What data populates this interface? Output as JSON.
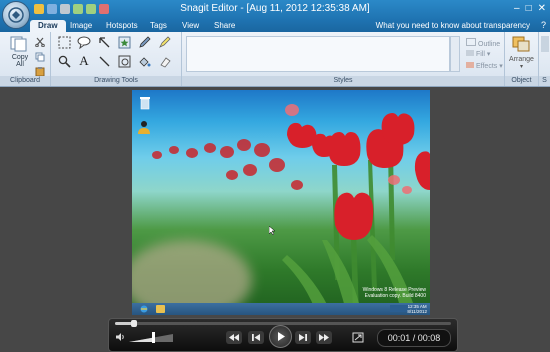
{
  "window": {
    "title": "Snagit Editor - [Aug 11, 2012 12:35:38 AM]",
    "controls": [
      "–",
      "□",
      "✕"
    ]
  },
  "tabs": [
    {
      "label": "Draw",
      "active": true
    },
    {
      "label": "Image"
    },
    {
      "label": "Hotspots"
    },
    {
      "label": "Tags"
    },
    {
      "label": "View"
    },
    {
      "label": "Share"
    }
  ],
  "help_link": "What you need to know about transparency",
  "ribbon": {
    "clipboard": {
      "label": "Clipboard",
      "copy_all_line1": "Copy",
      "copy_all_line2": "All"
    },
    "drawing_tools": {
      "label": "Drawing Tools"
    },
    "styles": {
      "label": "Styles",
      "outline": "Outline",
      "fill": "Fill",
      "effects": "Effects"
    },
    "object": {
      "label": "Object",
      "arrange": "Arrange"
    },
    "next_group_label": "S"
  },
  "desktop": {
    "watermark_line1": "Windows 8 Release Preview",
    "watermark_line2": "Evaluation copy. Build 8400",
    "clock_time": "12:35 AM",
    "clock_date": "8/11/2012"
  },
  "player": {
    "time": "00:01 / 00:08",
    "progress": 0.05,
    "volume": 0.55
  },
  "colors": {
    "accent": "#1f73b1",
    "ribbon_bg": "#eef3f9",
    "tulip_red": "#d8202a"
  }
}
